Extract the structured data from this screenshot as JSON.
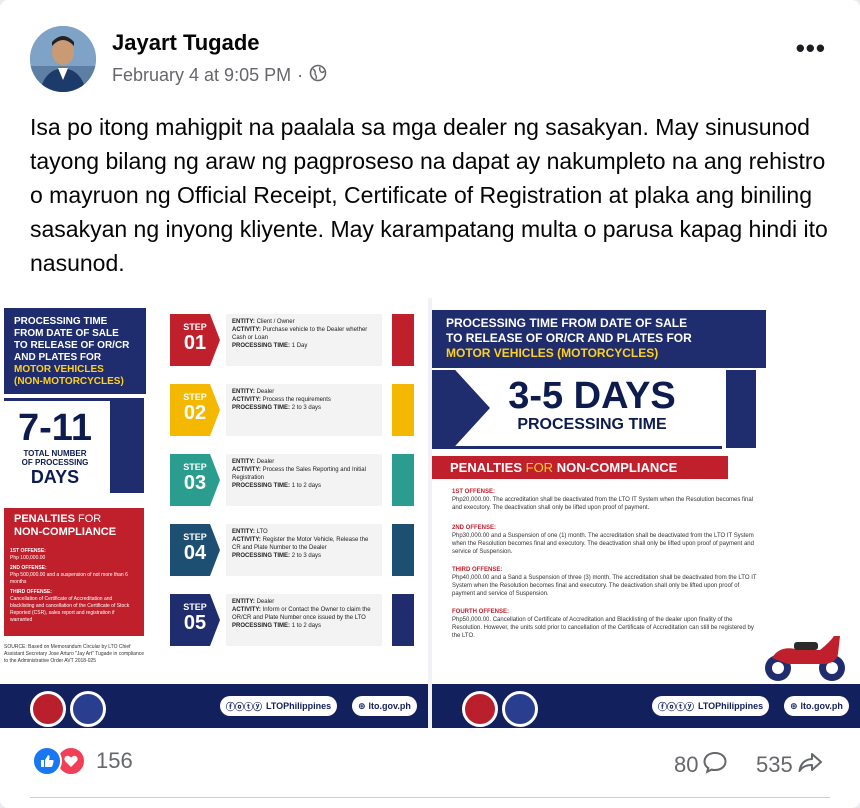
{
  "post": {
    "author": "Jayart Tugade",
    "timestamp": "February 4 at 9:05 PM",
    "separator": "·",
    "audience_icon": "globe-icon",
    "more_label": "•••",
    "text": "Isa po itong mahigpit na paalala sa mga dealer ng sasakyan. May sinusunod tayong bilang ng araw ng pagproseso na dapat ay nakumpleto na ang rehistro o mayruon ng Official Receipt, Certificate of Registration at plaka ang biniling sasakyan ng inyong kliyente. May karampatang multa o parusa kapag hindi ito nasunod."
  },
  "left_image": {
    "header_line1": "PROCESSING TIME",
    "header_line2": "FROM DATE OF SALE",
    "header_line3": "TO RELEASE OF OR/CR",
    "header_line4": "AND PLATES FOR",
    "header_line5": "MOTOR VEHICLES",
    "header_line6": "(NON-MOTORCYCLES)",
    "days": "7-11",
    "days_caption1": "TOTAL NUMBER",
    "days_caption2": "OF PROCESSING",
    "days_label": "DAYS",
    "penalties_title1": "PENALTIES",
    "penalties_title_for": "FOR",
    "penalties_title2": "NON-COMPLIANCE",
    "pen1_title": "1ST OFFENSE:",
    "pen1_text": "Php 100,000.00",
    "pen2_title": "2ND OFFENSE:",
    "pen2_text": "Php 500,000.00 and a suspension of not more than 6 months",
    "pen3_title": "THIRD OFFENSE:",
    "pen3_text": "Cancellation of Certificate of Accreditation and blacklisting and cancellation of the Certificate of Stock Reported (CSR), sales report and registration if warranted",
    "source": "SOURCE: Based on Memorandum Circular by LTO Chief Assistant Secretary Jose Arturo \"Jay Art\" Tugade in compliance to the Administrative Order AVT 2018-025",
    "steps": [
      {
        "label": "STEP",
        "num": "01",
        "entity": "Client / Owner",
        "activity": "Purchase vehicle to the Dealer whether Cash or Loan",
        "time": "1 Day",
        "color": "#c0202c"
      },
      {
        "label": "STEP",
        "num": "02",
        "entity": "Dealer",
        "activity": "Process the requirements",
        "time": "2 to 3 days",
        "color": "#f5b800"
      },
      {
        "label": "STEP",
        "num": "03",
        "entity": "Dealer",
        "activity": "Process the Sales Reporting and Initial Registration",
        "time": "1 to 2 days",
        "color": "#2a9d8f"
      },
      {
        "label": "STEP",
        "num": "04",
        "entity": "LTO",
        "activity": "Register the Motor Vehicle, Release the CR and Plate Number to the Dealer",
        "time": "2 to 3 days",
        "color": "#1d4f73"
      },
      {
        "label": "STEP",
        "num": "05",
        "entity": "Dealer",
        "activity": "Inform or Contact the Owner to claim the OR/CR and Plate Number once issued by the LTO",
        "time": "1 to 2 days",
        "color": "#1f2d6e"
      }
    ],
    "entity_label": "ENTITY:",
    "activity_label": "ACTIVITY:",
    "time_label": "PROCESSING TIME:",
    "social_handle": "LTOPhilippines",
    "website": "lto.gov.ph"
  },
  "right_image": {
    "header_line1": "PROCESSING TIME FROM DATE OF SALE",
    "header_line2": "TO RELEASE OF OR/CR AND PLATES FOR",
    "header_line3": "MOTOR VEHICLES (MOTORCYCLES)",
    "days": "3-5 DAYS",
    "days_caption": "PROCESSING TIME",
    "penalties_title1": "PENALTIES",
    "penalties_title_for": "FOR",
    "penalties_title2": "NON-COMPLIANCE",
    "pen1_title": "1ST OFFENSE:",
    "pen1_text": "Php20,000.00. The accreditation shall be deactivated from the LTO IT System when the Resolution becomes final and executory. The deactivation shall only be lifted upon proof of payment.",
    "pen2_title": "2ND OFFENSE:",
    "pen2_text": "Php30,000.00 and a Suspension of one (1) month. The accreditation shall be deactivated from the LTO IT System when the Resolution becomes final and executory. The deactivation shall only be lifted upon proof of payment and service of Suspension.",
    "pen3_title": "THIRD OFFENSE:",
    "pen3_text": "Php40,000.00 and a Sand a Suspension of three (3) month. The accreditation shall be deactivated from the LTO IT System when the Resolution becomes final and executory. The deactivation shall only be lifted upon proof of payment and service of Suspension.",
    "pen4_title": "FOURTH OFFENSE:",
    "pen4_text": "Php50,000.00. Cancellation of Certificate of Accreditation and Blacklisting of the dealer upon finality of the Resolution. However, the units sold prior to cancellation of the Certificate of Accreditation can still be registered by the LTO.",
    "social_handle": "LTOPhilippines",
    "website": "lto.gov.ph"
  },
  "stats": {
    "reactions_count": "156",
    "comments_count": "80",
    "shares_count": "535",
    "like_icon": "thumbs-up-icon",
    "love_icon": "heart-icon"
  },
  "colors": {
    "navy": "#1f2d6e",
    "red": "#c0202c",
    "yellow": "#ffd11c",
    "like_blue": "#1877f2",
    "love_red": "#f33e58"
  }
}
